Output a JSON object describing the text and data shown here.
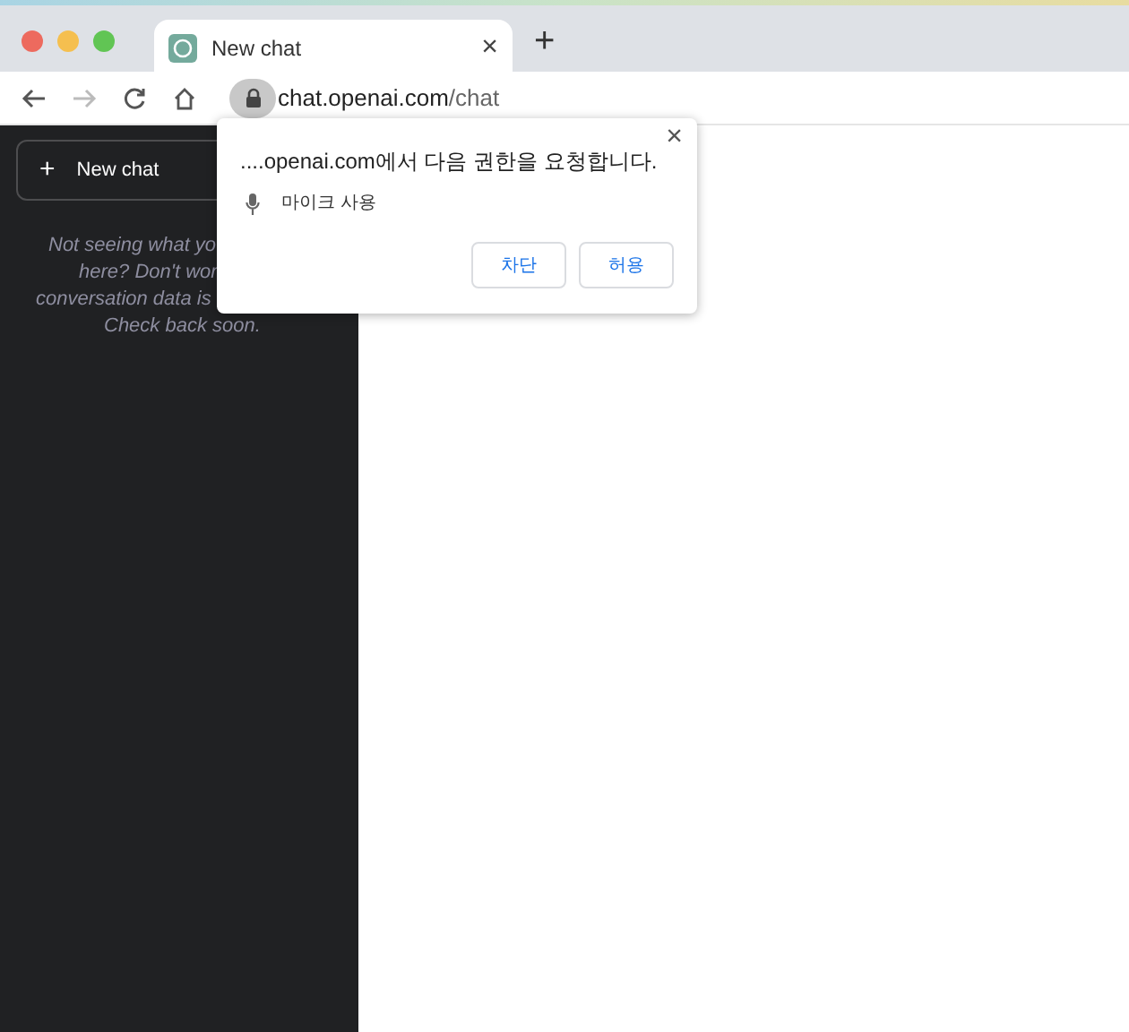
{
  "tabs": [
    {
      "title": "New chat",
      "close": "×",
      "selected": true
    }
  ],
  "new_tab": "+",
  "address": {
    "host": "chat.openai.com",
    "path": "/chat"
  },
  "sidebar": {
    "new_chat": {
      "icon": "+",
      "label": "New chat"
    },
    "notice_lines": [
      "Not seeing what yo",
      "here? Don't wor",
      "conversation data is",
      "Check back soon."
    ]
  },
  "permission_popup": {
    "title": "....openai.com에서 다음 권한을 요청합니다.",
    "close": "×",
    "permission": "마이크 사용",
    "buttons": [
      "차단",
      "허용"
    ]
  }
}
